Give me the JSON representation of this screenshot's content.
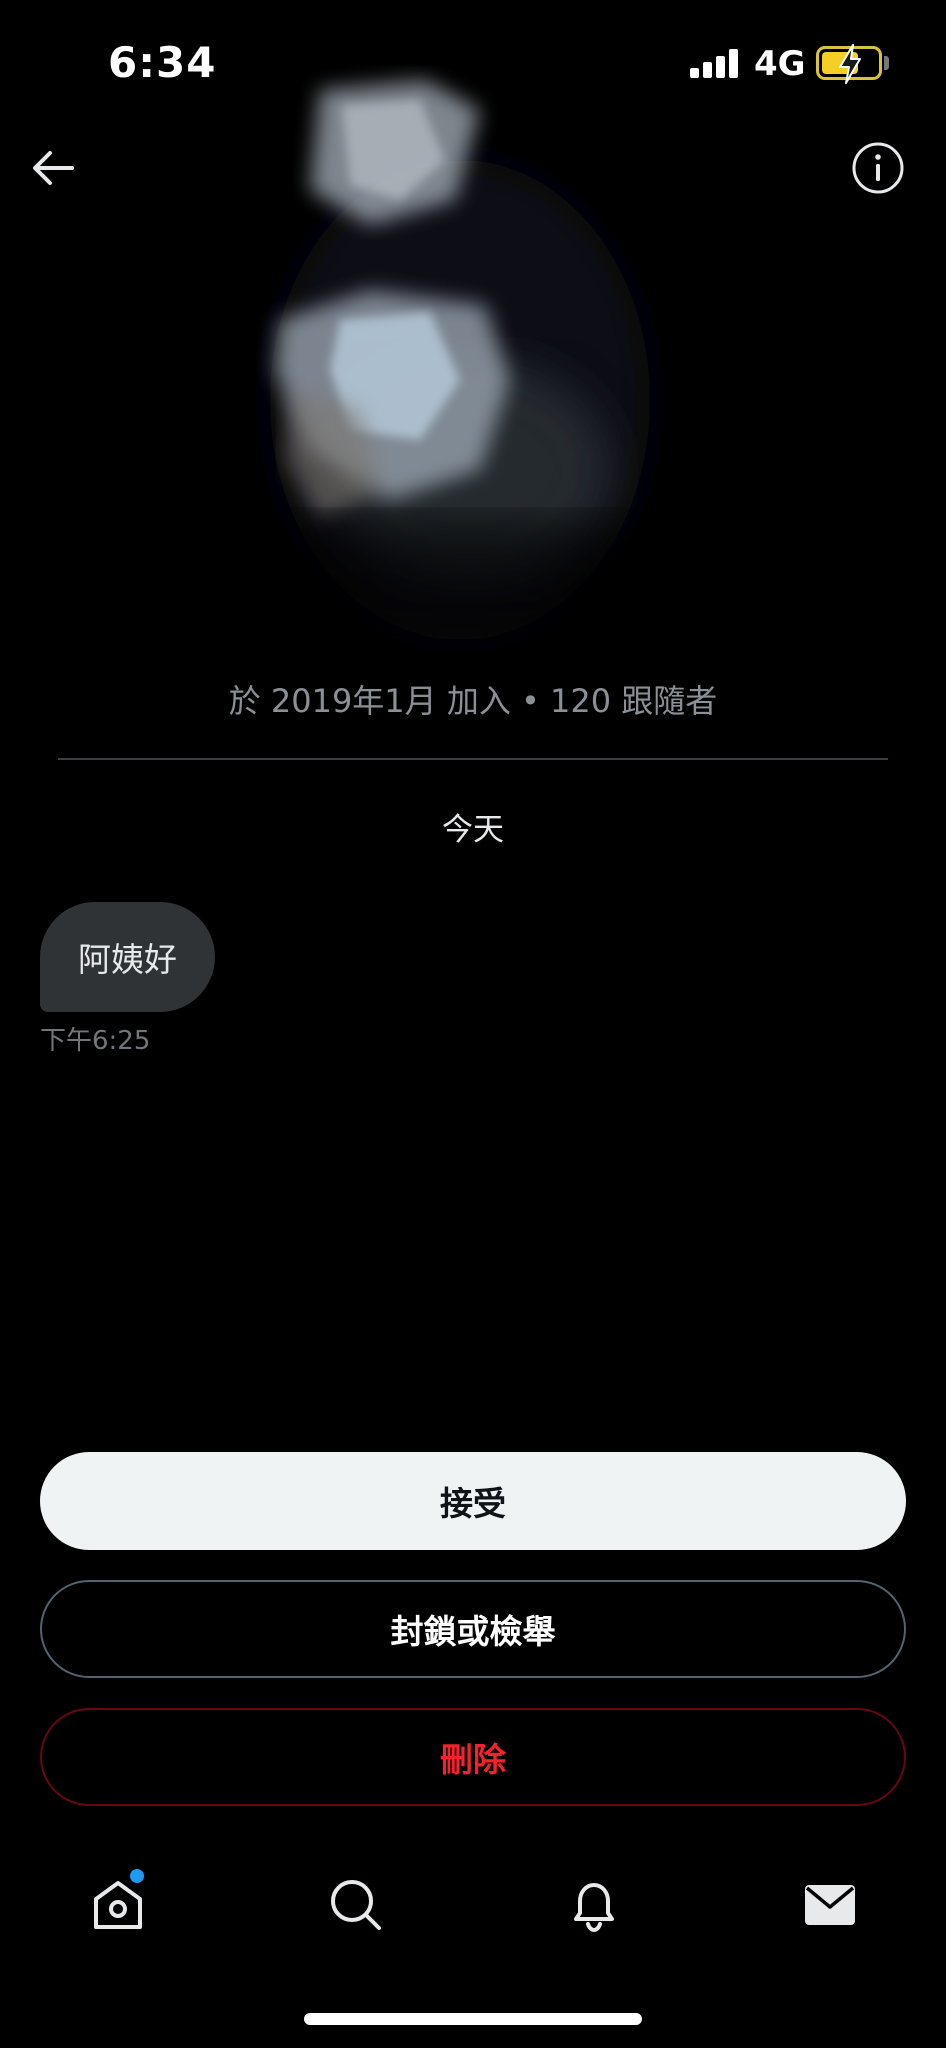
{
  "status_bar": {
    "time": "6:34",
    "network": "4G",
    "icons": [
      "cellular-signal-icon",
      "battery-charging-icon"
    ]
  },
  "header": {
    "icons": [
      "back-arrow-icon",
      "info-icon"
    ]
  },
  "profile": {
    "join_info": "於 2019年1月 加入 • 120 跟隨者"
  },
  "conversation": {
    "day_label": "今天",
    "messages": [
      {
        "text": "阿姨好",
        "time": "下午6:25"
      }
    ]
  },
  "actions": {
    "accept_label": "接受",
    "block_label": "封鎖或檢舉",
    "delete_label": "刪除"
  },
  "tab_bar": {
    "items": [
      "home-icon",
      "search-icon",
      "notifications-bell-icon",
      "messages-envelope-icon"
    ]
  },
  "colors": {
    "background": "#000000",
    "bubble": "#2f3336",
    "accept_bg": "#eff3f4",
    "delete_red": "#f4212e",
    "accent_blue": "#1d9bf0",
    "battery_yellow": "#f4d024"
  }
}
